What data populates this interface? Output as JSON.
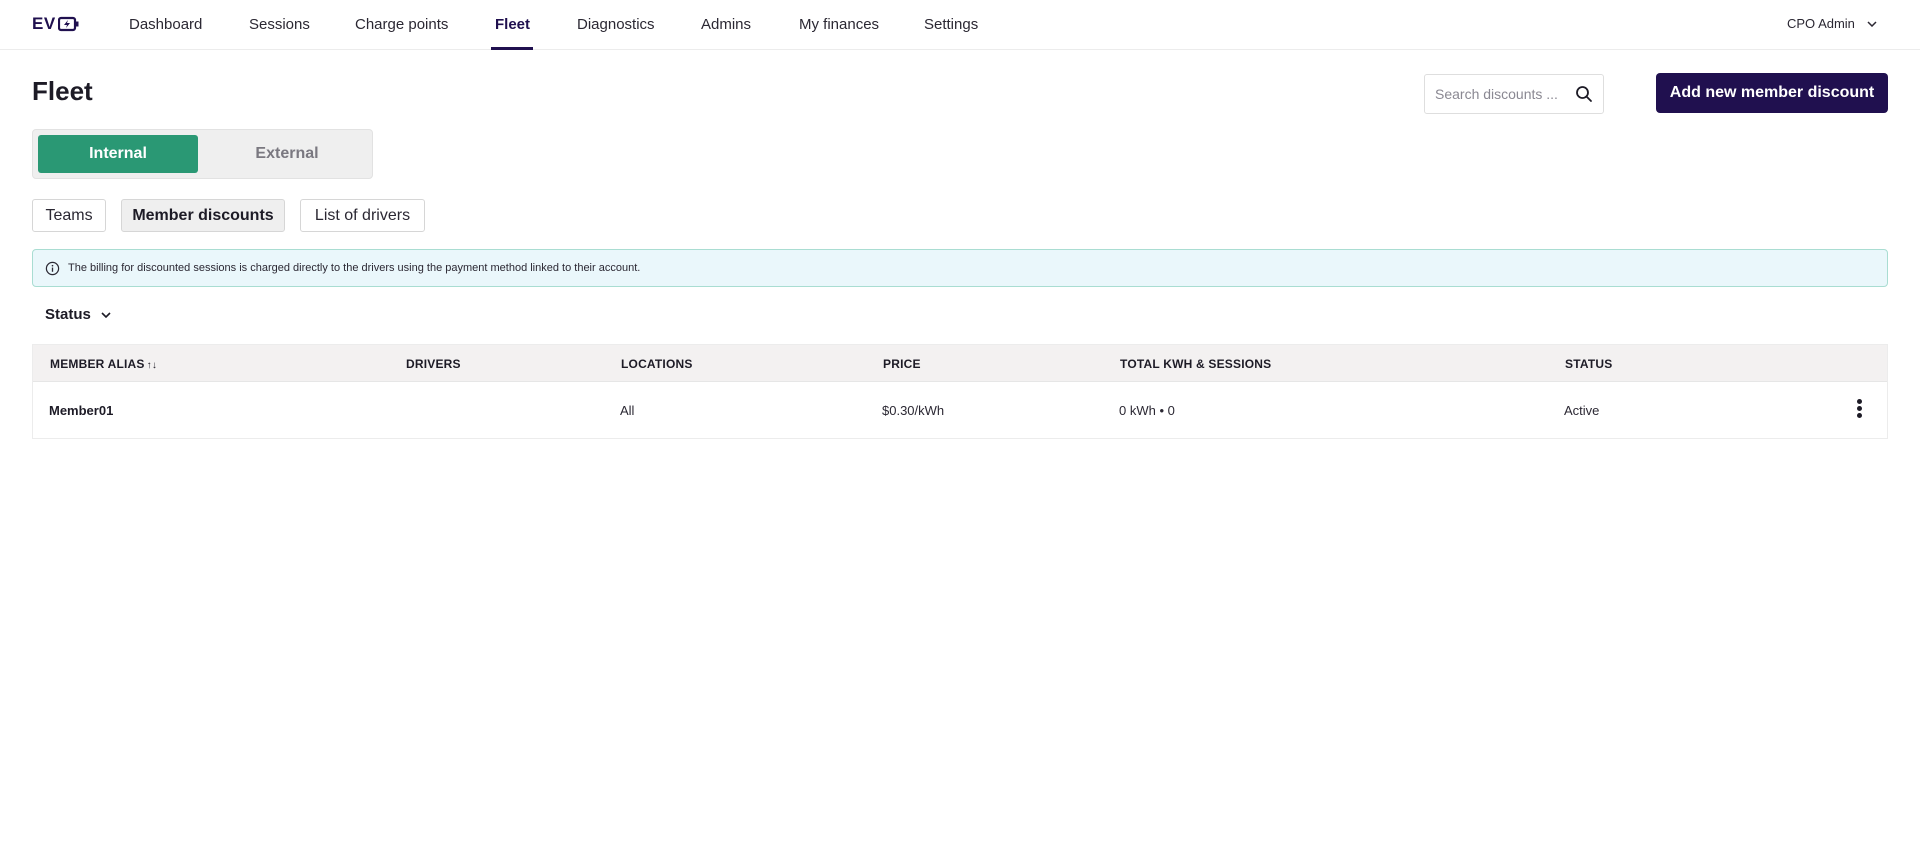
{
  "app": {
    "logo_text": "EV"
  },
  "nav": {
    "items": [
      {
        "label": "Dashboard"
      },
      {
        "label": "Sessions"
      },
      {
        "label": "Charge points"
      },
      {
        "label": "Fleet"
      },
      {
        "label": "Diagnostics"
      },
      {
        "label": "Admins"
      },
      {
        "label": "My finances"
      },
      {
        "label": "Settings"
      }
    ],
    "active": "Fleet",
    "user": "CPO Admin"
  },
  "header": {
    "title": "Fleet",
    "search_placeholder": "Search discounts ...",
    "add_button": "Add new member discount"
  },
  "segment": {
    "internal": "Internal",
    "external": "External",
    "selected": "Internal"
  },
  "subtabs": [
    {
      "label": "Teams"
    },
    {
      "label": "Member discounts"
    },
    {
      "label": "List of drivers"
    }
  ],
  "info_banner": "The billing for discounted sessions is charged directly to the drivers using the payment method linked to their account.",
  "filter": {
    "status_label": "Status"
  },
  "table": {
    "headers": {
      "alias": "MEMBER ALIAS",
      "drivers": "DRIVERS",
      "locations": "LOCATIONS",
      "price": "PRICE",
      "total": "TOTAL KWH & SESSIONS",
      "status": "STATUS"
    },
    "rows": [
      {
        "alias": "Member01",
        "drivers": "",
        "locations": "All",
        "price": "$0.30/kWh",
        "total": "0 kWh • 0",
        "status": "Active"
      }
    ]
  },
  "colors": {
    "brand": "#20104f",
    "accent_green": "#2a9874",
    "info_bg": "#eaf7fb"
  }
}
